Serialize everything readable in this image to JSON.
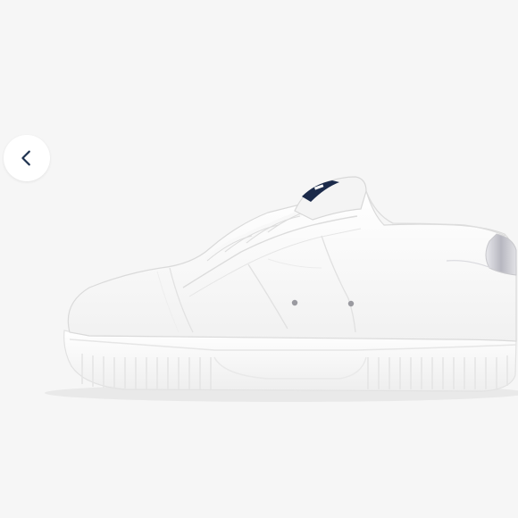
{
  "gallery": {
    "image_subject": "white-platform-sneaker",
    "prev_icon": "chevron-left-icon",
    "colors": {
      "background": "#f6f6f6",
      "button_bg": "#ffffff",
      "chevron": "#1f3350",
      "shoe_upper": "#fafafa",
      "shoe_outline": "#dcdcdc",
      "heel_tab": "#b8b8c0",
      "tongue_label": "#1b2a4a"
    }
  }
}
